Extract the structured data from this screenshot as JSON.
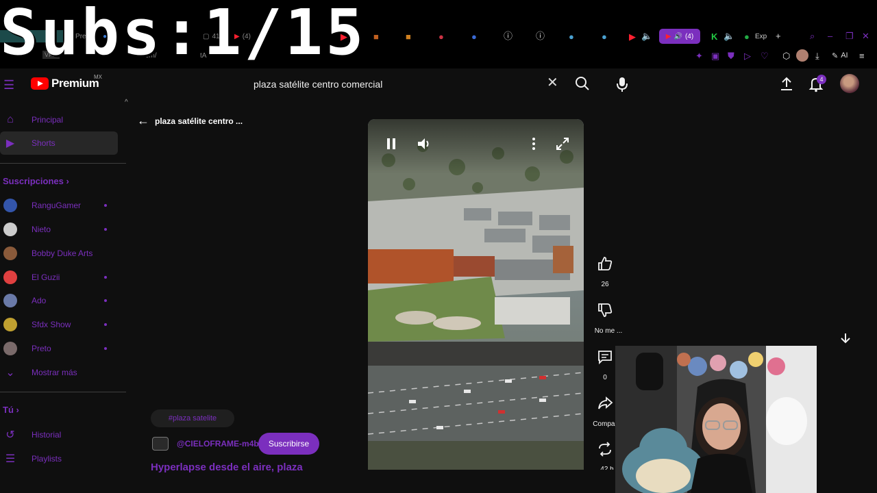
{
  "overlay": {
    "counter": "Subs:1/15"
  },
  "browser": {
    "tabs": [
      {
        "label": "Pre"
      },
      {
        "label": "Art"
      },
      {
        "label": "414"
      },
      {
        "label": "(4)"
      }
    ],
    "audio_tab_count": "(4)",
    "ext_tab_label": "Exp",
    "url_fragment": "om/",
    "url_fragment_2": "tA",
    "vpn_badge": "VPN",
    "ai_label": "AI"
  },
  "header": {
    "logo_text": "Premium",
    "region": "MX",
    "search_value": "plaza satélite centro comercial",
    "notification_count": "4"
  },
  "sidebar": {
    "main": [
      {
        "label": "Principal",
        "icon": "home-icon"
      },
      {
        "label": "Shorts",
        "icon": "shorts-icon",
        "active": true
      }
    ],
    "subscriptions_heading": "Suscripciones",
    "subscriptions": [
      {
        "label": "RanguGamer",
        "dot": true,
        "color": "#3355aa"
      },
      {
        "label": "Nieto",
        "dot": true,
        "color": "#cccccc"
      },
      {
        "label": "Bobby Duke Arts",
        "dot": false,
        "color": "#8a5a3a"
      },
      {
        "label": "El Guzii",
        "dot": true,
        "color": "#e04040"
      },
      {
        "label": "Ado",
        "dot": true,
        "color": "#6a7aa8"
      },
      {
        "label": "Sfdx Show",
        "dot": true,
        "color": "#c0a030"
      },
      {
        "label": "Preto",
        "dot": true,
        "color": "#7a6a6a"
      }
    ],
    "show_more": "Mostrar más",
    "you_heading": "Tú",
    "you_items": [
      {
        "label": "Historial",
        "icon": "history-icon"
      },
      {
        "label": "Playlists",
        "icon": "playlist-icon"
      }
    ]
  },
  "content": {
    "back_title": "plaza satélite centro ...",
    "tag_pill": "#plaza satelite",
    "channel_name": "@CIELOFRAME-m4b",
    "subscribe_label": "Suscribirse",
    "video_title": "Hyperlapse desde el aire, plaza"
  },
  "actions": {
    "likes": "26",
    "dislike_label": "No me ...",
    "comments": "0",
    "share_label": "Compar",
    "remix_label": "42 h"
  },
  "colors": {
    "accent": "#7b2fbe",
    "logo_red": "#ff0000",
    "background": "#0f0f0f"
  }
}
